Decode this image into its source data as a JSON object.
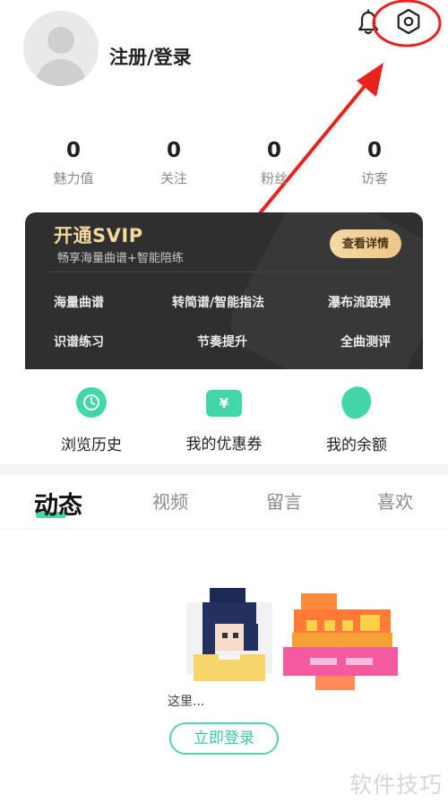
{
  "header": {
    "login_title": "注册/登录"
  },
  "stats": [
    {
      "value": "0",
      "label": "魅力值"
    },
    {
      "value": "0",
      "label": "关注"
    },
    {
      "value": "0",
      "label": "粉丝"
    },
    {
      "value": "0",
      "label": "访客"
    }
  ],
  "svip": {
    "title": "开通SVIP",
    "subtitle": "畅享海量曲谱+智能陪练",
    "detail_button": "查看详情",
    "features": [
      "海量曲谱",
      "转简谱/智能指法",
      "瀑布流跟弹",
      "识谱练习",
      "节奏提升",
      "全曲测评"
    ]
  },
  "quick_actions": [
    {
      "label": "浏览历史",
      "icon": "clock-icon"
    },
    {
      "label": "我的优惠券",
      "icon": "coupon-icon"
    },
    {
      "label": "我的余额",
      "icon": "balance-icon"
    }
  ],
  "tabs": [
    "动态",
    "视频",
    "留言",
    "喜欢"
  ],
  "empty_state": {
    "text": "这里...",
    "login_button": "立即登录"
  },
  "watermark": "软件技巧",
  "colors": {
    "accent": "#43d6a8",
    "svip_gold": "#f3d69a",
    "annotation_red": "#e8221c"
  }
}
